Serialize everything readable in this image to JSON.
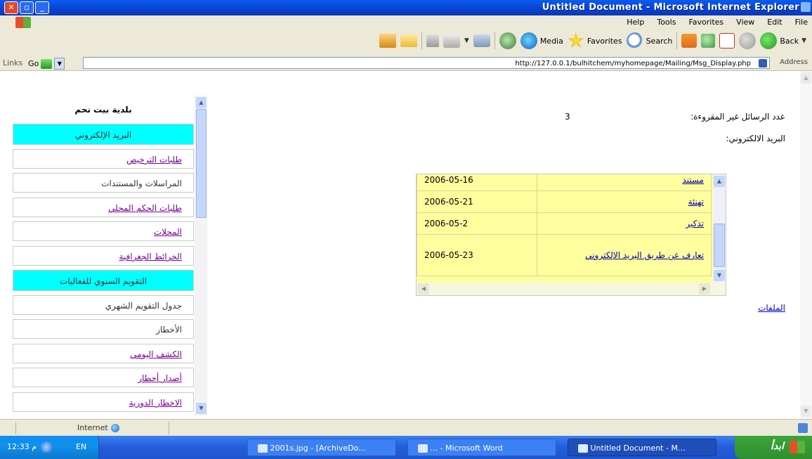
{
  "window": {
    "title": "Untitled Document - Microsoft Internet Explorer"
  },
  "menu": [
    "File",
    "Edit",
    "View",
    "Favorites",
    "Tools",
    "Help"
  ],
  "toolbar": {
    "back": "Back",
    "search": "Search",
    "favorites": "Favorites",
    "media": "Media"
  },
  "address": {
    "label": "Address",
    "url": "http://127.0.0.1/bulhitchem/myhomepage/Mailing/Msg_Display.php",
    "go": "Go",
    "links": "Links"
  },
  "sidebar": {
    "title": "بلدية بيت نحم",
    "items": [
      {
        "label": "البريد الإلكتروني",
        "kind": "header"
      },
      {
        "label": "طلبات الترخيص",
        "kind": "link"
      },
      {
        "label": "المراسلات والمستندات",
        "kind": "plain"
      },
      {
        "label": "طلبات الحكم المحلي",
        "kind": "link"
      },
      {
        "label": "المحلات",
        "kind": "link"
      },
      {
        "label": "الخرائط الجغرافية",
        "kind": "link"
      },
      {
        "label": "التقويم السنوي للفعاليات",
        "kind": "header"
      },
      {
        "label": "جدول التقويم الشهري",
        "kind": "plain"
      },
      {
        "label": "الأخطار",
        "kind": "plain"
      },
      {
        "label": "الكشف اليومي",
        "kind": "link"
      },
      {
        "label": "أصدار أخطار",
        "kind": "link"
      },
      {
        "label": "الاخطار الدورية",
        "kind": "link"
      }
    ]
  },
  "main": {
    "unread_label": "عدد الرسائل غير المقروءة:",
    "unread_count": "3",
    "inbox_label": "البريد الالكتروني:",
    "files_label": "الملفات",
    "messages": [
      {
        "subject": "مستند",
        "date": "2006-05-16"
      },
      {
        "subject": "تهنئة",
        "date": "2006-05-21"
      },
      {
        "subject": "تذكير",
        "date": "2006-05-2"
      },
      {
        "subject": "تعارف عن طريق البريد الإلكتروني",
        "date": "2006-05-23"
      }
    ]
  },
  "statusbar": {
    "zone": "Internet"
  },
  "taskbar": {
    "start": "ابدأ",
    "clock": "12:33 م",
    "lang": "EN",
    "tasks": [
      {
        "label": "Untitled Document - M...",
        "active": true
      },
      {
        "label": "... - Microsoft Word",
        "active": false
      },
      {
        "label": "2001s.jpg - [ArchiveDo...",
        "active": false
      }
    ]
  }
}
